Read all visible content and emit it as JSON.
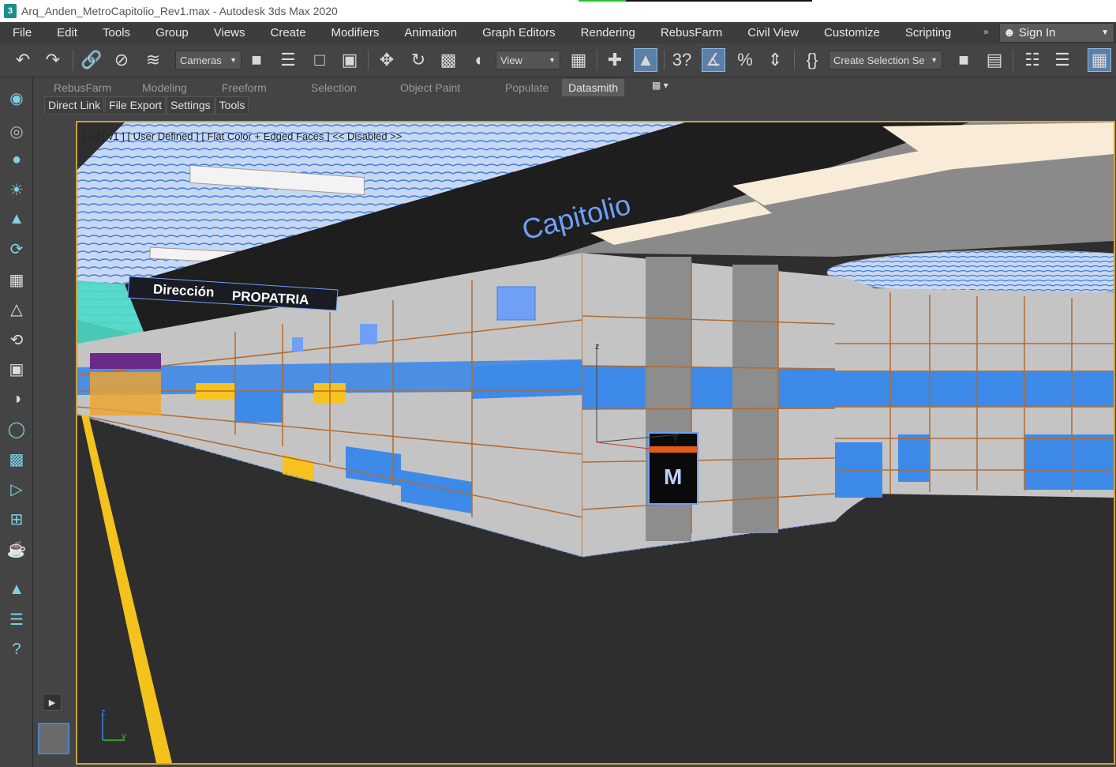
{
  "window": {
    "title": "Arq_Anden_MetroCapitolio_Rev1.max - Autodesk 3ds Max 2020",
    "app_icon": "3"
  },
  "menu": {
    "items": [
      "File",
      "Edit",
      "Tools",
      "Group",
      "Views",
      "Create",
      "Modifiers",
      "Animation",
      "Graph Editors",
      "Rendering",
      "RebusFarm",
      "Civil View",
      "Customize",
      "Scripting"
    ],
    "overflow": "»",
    "sign_in": "Sign In"
  },
  "toolbar": {
    "cameras_dropdown": "Cameras",
    "view_dropdown": "View",
    "selection_set_dropdown": "Create Selection Se",
    "icons": [
      "undo-icon",
      "redo-icon",
      "link-icon",
      "unlink-icon",
      "bind-spacewarp-icon",
      "select-object-icon",
      "select-by-name-icon",
      "rect-selection-icon",
      "window-crossing-icon",
      "move-icon",
      "rotate-icon",
      "scale-icon",
      "place-icon",
      "select-manipulate-icon",
      "snap-icon",
      "angle-snap-icon",
      "percent-snap-icon",
      "spinner-snap-icon",
      "named-selection-icon",
      "mirror-icon",
      "align-icon",
      "scene-explorer-icon",
      "layer-explorer-icon",
      "ribbon-toggle-icon"
    ]
  },
  "ribbon": {
    "tabs": [
      "RebusFarm",
      "Modeling",
      "Freeform",
      "Selection",
      "Object Paint",
      "Populate",
      "Datasmith"
    ],
    "active_tab": "Datasmith",
    "subtabs": [
      "Direct Link",
      "File Export",
      "Settings",
      "Tools"
    ]
  },
  "command_panel": {
    "icons": [
      "camera-icon",
      "camera-target-icon",
      "light-bulb-icon",
      "sun-icon",
      "tree-icon",
      "orbit-icon",
      "panorama-icon",
      "tree-small-icon",
      "teapot-rotate-icon",
      "image-icon",
      "sphere-icon",
      "lamp-icon",
      "render-frame-icon",
      "render-setup-icon",
      "viewport-icon",
      "teapot-icon",
      "trees-icon",
      "list-icon",
      "help-icon"
    ]
  },
  "viewport": {
    "label": "[ + ] [ v1 ] [ User Defined ] [ Flat Color + Edged Faces ]  << Disabled >>",
    "scene_texts": {
      "ceiling_sign": "Capitolio",
      "direction_sign_left": "Dirección",
      "direction_sign_right": "PROPATRIA",
      "metro_logo": "M",
      "gizmo_z": "z",
      "gizmo_y": "y",
      "axis_z": "z",
      "axis_y": "y"
    },
    "colors": {
      "viewport_bg": "#2a2a2a",
      "frame": "#c8a24a",
      "accent_blue": "#3d8ae8",
      "accent_yellow": "#f7c31f"
    }
  }
}
